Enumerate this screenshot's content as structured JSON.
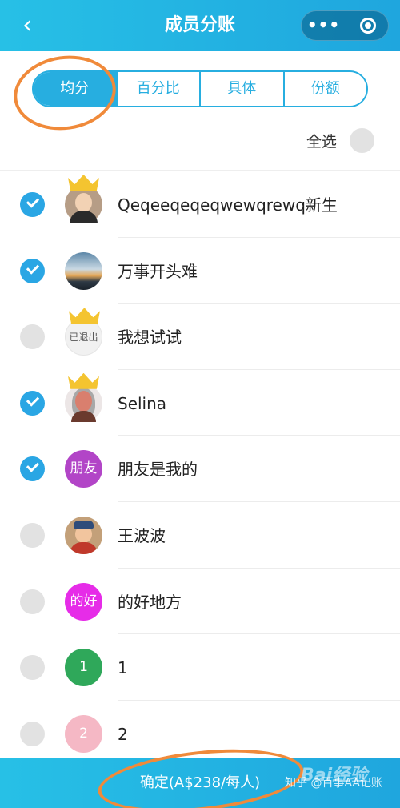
{
  "header": {
    "title": "成员分账",
    "back_icon": "‹",
    "more_icon": "•••"
  },
  "tabs": [
    {
      "label": "均分",
      "active": true
    },
    {
      "label": "百分比",
      "active": false
    },
    {
      "label": "具体",
      "active": false
    },
    {
      "label": "份额",
      "active": false
    }
  ],
  "select_all": {
    "label": "全选",
    "checked": false
  },
  "members": [
    {
      "name": "Qeqeeqeqeqwewqrewq新生",
      "checked": true,
      "crown": true,
      "avatar_text": ""
    },
    {
      "name": "万事开头难",
      "checked": true,
      "crown": false,
      "avatar_text": ""
    },
    {
      "name": "我想试试",
      "checked": false,
      "crown": true,
      "avatar_text": "已退出"
    },
    {
      "name": "Selina",
      "checked": true,
      "crown": true,
      "avatar_text": ""
    },
    {
      "name": "朋友是我的",
      "checked": true,
      "crown": false,
      "avatar_text": "朋友"
    },
    {
      "name": "王波波",
      "checked": false,
      "crown": false,
      "avatar_text": ""
    },
    {
      "name": "的好地方",
      "checked": false,
      "crown": false,
      "avatar_text": "的好"
    },
    {
      "name": "1",
      "checked": false,
      "crown": false,
      "avatar_text": "1"
    },
    {
      "name": "2",
      "checked": false,
      "crown": false,
      "avatar_text": "2"
    }
  ],
  "footer": {
    "confirm_label": "确定(A$238/每人)"
  },
  "watermark": {
    "text": "知乎 @百事AA记账",
    "baidu": "Bai经验"
  },
  "colors": {
    "accent": "#27aee0",
    "annotation": "#f08a3a",
    "check": "#2aa6e4"
  }
}
